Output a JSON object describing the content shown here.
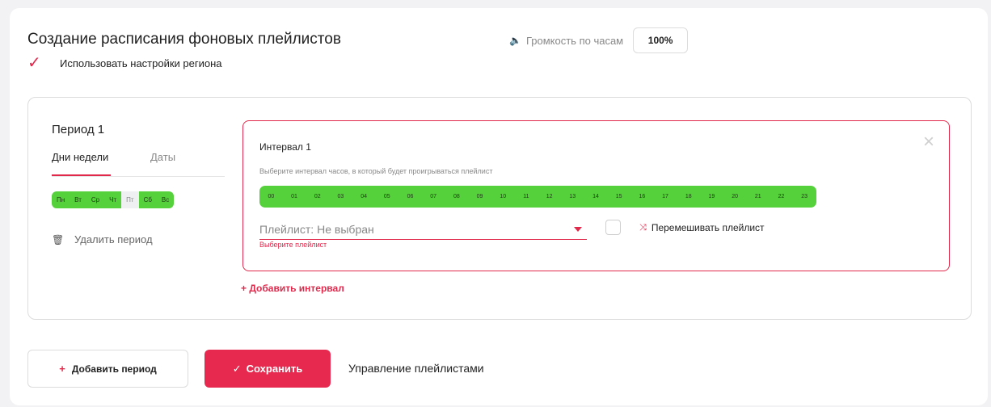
{
  "header": {
    "title": "Создание расписания фоновых плейлистов",
    "use_region_label": "Использовать настройки региона",
    "use_region_checked": true,
    "volume_label": "Громкость по часам",
    "volume_value": "100%"
  },
  "period": {
    "title": "Период 1",
    "tabs": [
      {
        "label": "Дни недели",
        "active": true
      },
      {
        "label": "Даты",
        "active": false
      }
    ],
    "days": [
      {
        "label": "Пн",
        "selected": true
      },
      {
        "label": "Вт",
        "selected": true
      },
      {
        "label": "Ср",
        "selected": true
      },
      {
        "label": "Чт",
        "selected": true
      },
      {
        "label": "Пт",
        "selected": false
      },
      {
        "label": "Сб",
        "selected": true
      },
      {
        "label": "Вс",
        "selected": true
      }
    ],
    "delete_label": "Удалить период"
  },
  "interval": {
    "title": "Интервал 1",
    "hint": "Выберите интервал часов, в который будет проигрываться плейлист",
    "hours": [
      "00",
      "01",
      "02",
      "03",
      "04",
      "05",
      "06",
      "07",
      "08",
      "09",
      "10",
      "11",
      "12",
      "13",
      "14",
      "15",
      "16",
      "17",
      "18",
      "19",
      "20",
      "21",
      "22",
      "23"
    ],
    "playlist_label": "Плейлист:",
    "playlist_value": "Не выбран",
    "playlist_error": "Выберите плейлист",
    "shuffle_label": "Перемешивать плейлист",
    "close_symbol": "×"
  },
  "actions": {
    "add_interval": "+ Добавить интервал",
    "add_period_plus": "+",
    "add_period": "Добавить период",
    "save_check": "✓",
    "save": "Сохранить",
    "manage_playlists": "Управление плейлистами"
  },
  "colors": {
    "accent": "#e0294b",
    "selected_green": "#55d13b",
    "unselected": "#eef0f2"
  }
}
